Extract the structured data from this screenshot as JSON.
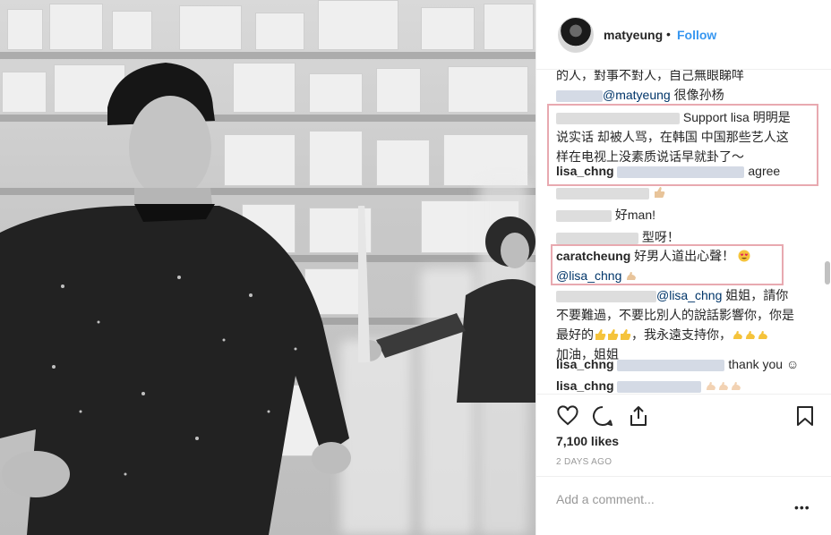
{
  "post": {
    "username": "matyeung",
    "separator": "•",
    "follow_label": "Follow",
    "likes": "7,100 likes",
    "date": "2 DAYS AGO",
    "add_comment_placeholder": "Add a comment...",
    "more_label": "•••"
  },
  "comments": [
    {
      "text": "的人，對事不對人，自己無眼睇咩"
    },
    {
      "mention": "@matyeung",
      "text": " 很像孙杨"
    },
    {
      "text1": "Support lisa 明明是",
      "text2": "说实话 却被人骂，在韩国 中国那些艺人这",
      "text3": "样在电视上没素质说话早就卦了～"
    },
    {
      "user": "lisa_chng",
      "text": "agree"
    },
    {
      "text": "好man!"
    },
    {
      "text": "型呀！"
    },
    {
      "user": "caratcheung",
      "text": "好男人道出心聲！",
      "mention": "@lisa_chng"
    },
    {
      "mention": "@lisa_chng",
      "text1": " 姐姐，請你",
      "text2": "不要難過，不要比別人的說話影響你，你是",
      "text3a": "最好的",
      "text3b": "，我永遠支持你，",
      "text4": "加油，姐姐"
    },
    {
      "user": "lisa_chng",
      "text": "thank you ☺"
    },
    {
      "user": "lisa_chng",
      "text": ""
    }
  ],
  "icons": {
    "heart": "heart-icon",
    "comment": "comment-icon",
    "share": "share-icon",
    "bookmark": "bookmark-icon"
  },
  "colors": {
    "link": "#3897f0",
    "mention": "#003569",
    "highlight_box": "#e8a9b0",
    "muted": "#999999"
  }
}
